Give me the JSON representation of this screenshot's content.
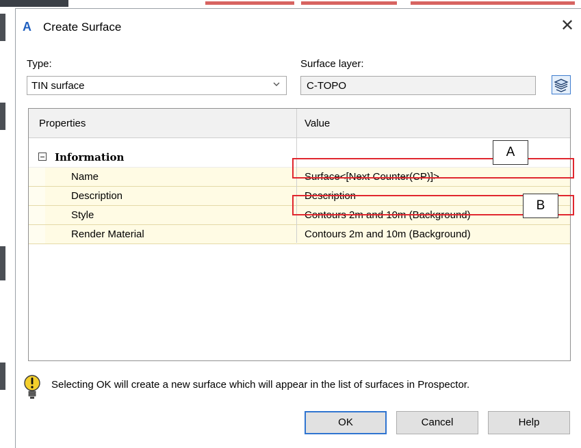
{
  "dialog": {
    "title": "Create Surface",
    "close_glyph": "✕"
  },
  "type": {
    "label": "Type:",
    "value": "TIN surface"
  },
  "surface_layer": {
    "label": "Surface layer:",
    "value": "C-TOPO"
  },
  "grid": {
    "headers": [
      "Properties",
      "Value"
    ],
    "category": "Information",
    "rows": [
      {
        "key": "Name",
        "value": "Surface<[Next Counter(CP)]>"
      },
      {
        "key": "Description",
        "value": "Description"
      },
      {
        "key": "Style",
        "value": "Contours 2m and 10m (Background)"
      },
      {
        "key": "Render Material",
        "value": "Contours 2m and 10m (Background)"
      }
    ]
  },
  "annotations": {
    "a": "A",
    "b": "B"
  },
  "note": "Selecting OK will create a new surface which will appear in the list of surfaces in Prospector.",
  "buttons": {
    "ok": "OK",
    "cancel": "Cancel",
    "help": "Help"
  },
  "colors": {
    "accent": "#2f74d0",
    "annotation_red": "#e0262e",
    "row_highlight": "#fffbe4",
    "warning_yellow": "#f4cf2c"
  },
  "icons": {
    "app": "autodesk-civil3d-icon",
    "layer_button": "layer-stack-icon",
    "note": "lightbulb-warning-icon",
    "expander": "collapse-minus-icon",
    "dropdown": "chevron-down-icon"
  }
}
